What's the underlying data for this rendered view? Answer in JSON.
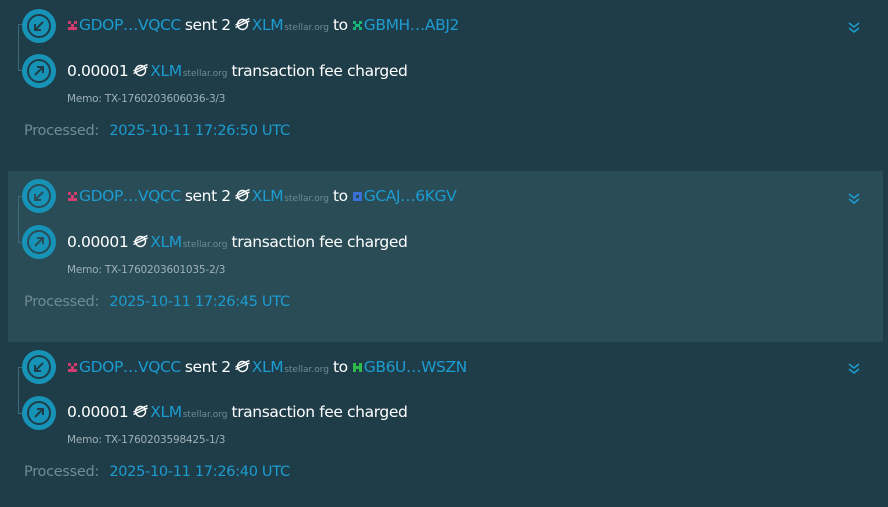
{
  "transactions": [
    {
      "source_account": "GDOP…VQCC",
      "verb": "sent 2",
      "asset_code": "XLM",
      "asset_domain": "stellar.org",
      "to_word": "to",
      "dest_account": "GBMH…ABJ2",
      "dest_color": "#19b67a",
      "fee_amount": "0.00001",
      "fee_asset_code": "XLM",
      "fee_asset_domain": "stellar.org",
      "fee_text": "transaction fee charged",
      "memo": "Memo: TX-1760203606036-3/3",
      "processed_label": "Processed:",
      "processed_time": "2025-10-11 17:26:50 UTC"
    },
    {
      "source_account": "GDOP…VQCC",
      "verb": "sent 2",
      "asset_code": "XLM",
      "asset_domain": "stellar.org",
      "to_word": "to",
      "dest_account": "GCAJ…6KGV",
      "dest_color": "#3a6fd8",
      "fee_amount": "0.00001",
      "fee_asset_code": "XLM",
      "fee_asset_domain": "stellar.org",
      "fee_text": "transaction fee charged",
      "memo": "Memo: TX-1760203601035-2/3",
      "processed_label": "Processed:",
      "processed_time": "2025-10-11 17:26:45 UTC"
    },
    {
      "source_account": "GDOP…VQCC",
      "verb": "sent 2",
      "asset_code": "XLM",
      "asset_domain": "stellar.org",
      "to_word": "to",
      "dest_account": "GB6U…WSZN",
      "dest_color": "#2fb84a",
      "fee_amount": "0.00001",
      "fee_asset_code": "XLM",
      "fee_asset_domain": "stellar.org",
      "fee_text": "transaction fee charged",
      "memo": "Memo: TX-1760203598425-1/3",
      "processed_label": "Processed:",
      "processed_time": "2025-10-11 17:26:40 UTC"
    }
  ],
  "source_color": "#d23b6e",
  "icons": {
    "incoming_op": "arrow-down-left-icon",
    "fee_op": "arrow-up-right-icon",
    "asset": "stellar-logo-icon",
    "expand": "chevron-double-down-icon",
    "account": "identicon-icon"
  }
}
